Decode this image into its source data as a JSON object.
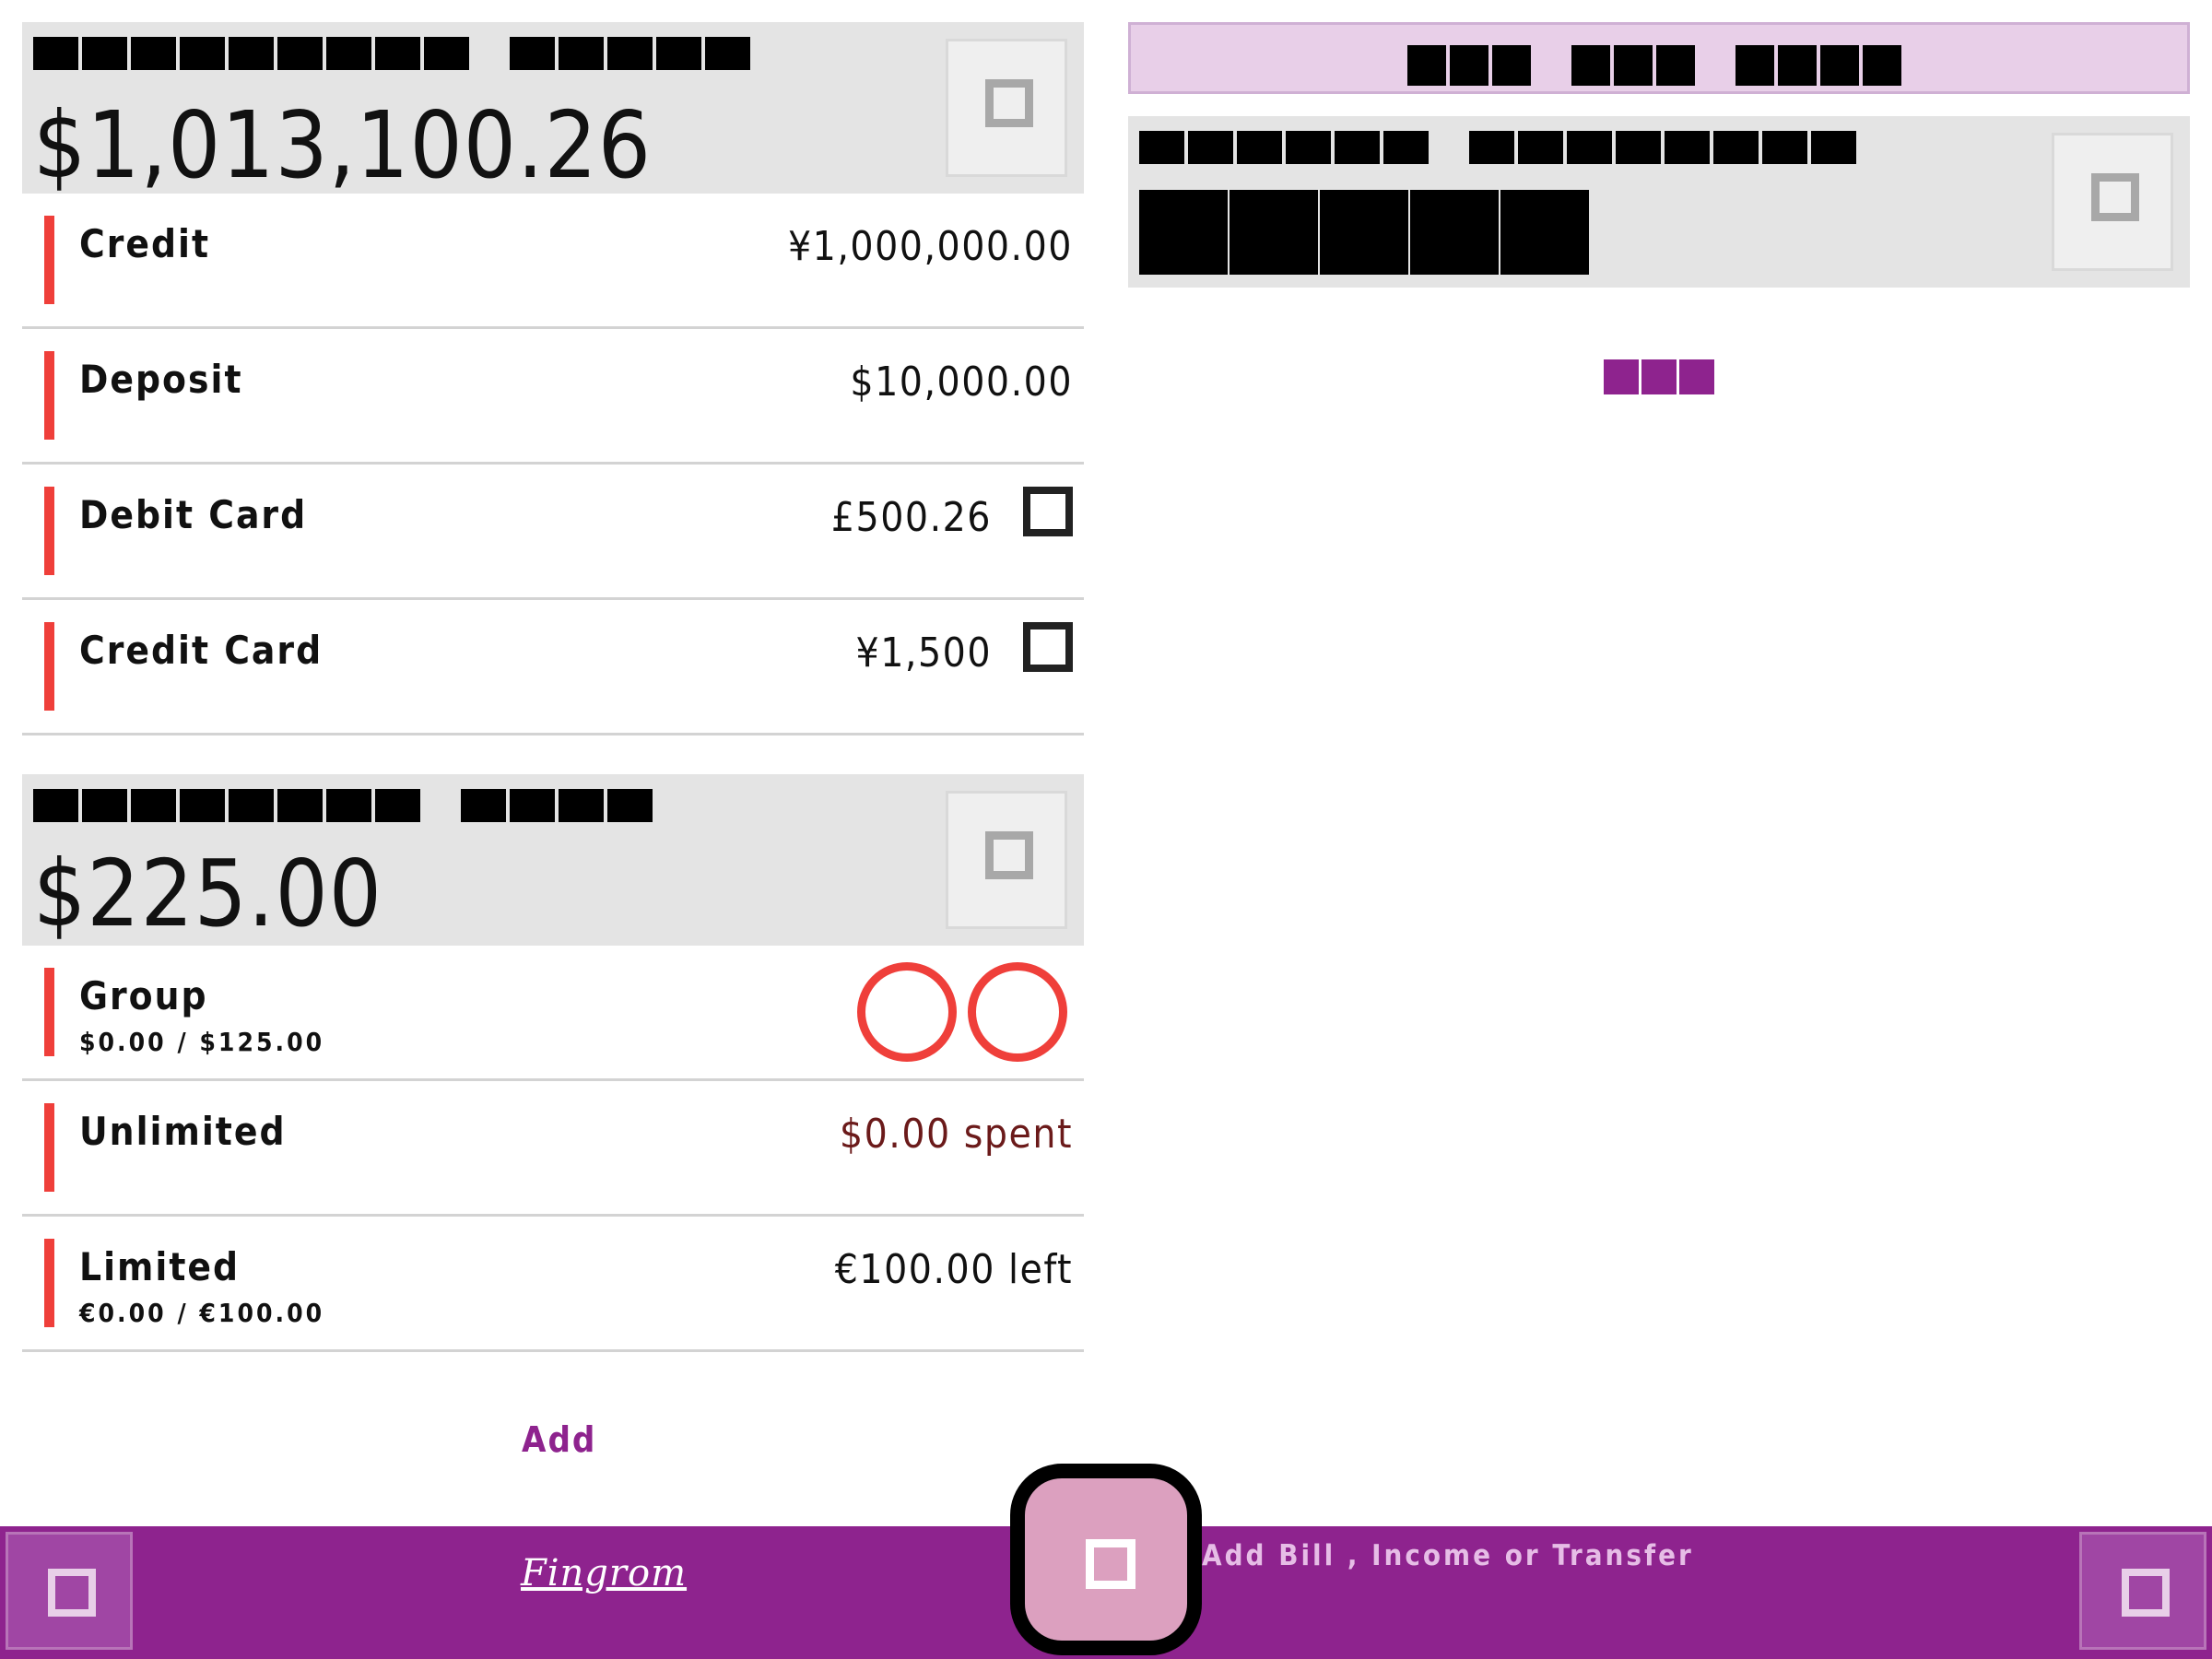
{
  "accounts": {
    "total": "$1,013,100.26",
    "items": [
      {
        "name": "Credit",
        "value": "¥1,000,000.00",
        "has_checkbox": false
      },
      {
        "name": "Deposit",
        "value": "$10,000.00",
        "has_checkbox": false
      },
      {
        "name": "Debit Card",
        "value": "£500.26",
        "has_checkbox": true
      },
      {
        "name": "Credit Card",
        "value": "¥1,500",
        "has_checkbox": true
      }
    ]
  },
  "budgets": {
    "total": "$225.00",
    "items": [
      {
        "name": "Group",
        "sub": "$0.00 / $125.00"
      },
      {
        "name": "Unlimited",
        "value": "$0.00 spent",
        "value_color": "#6b1a1a"
      },
      {
        "name": "Limited",
        "sub": "€0.00 / €100.00",
        "value": "€100.00 left"
      }
    ],
    "add_label": "Add"
  },
  "bottom_bar": {
    "logo": "Fingrom",
    "fab_label": "Add Bill , Income or Transfer"
  },
  "colors": {
    "accent": "#8e238e",
    "indicator": "#ef3f3a",
    "banner": "#e8cfe8",
    "panel": "#e4e4e4"
  },
  "icons": {
    "panel_action": "square-icon",
    "fab": "square-icon",
    "nav_left": "square-icon",
    "nav_right": "square-icon"
  }
}
